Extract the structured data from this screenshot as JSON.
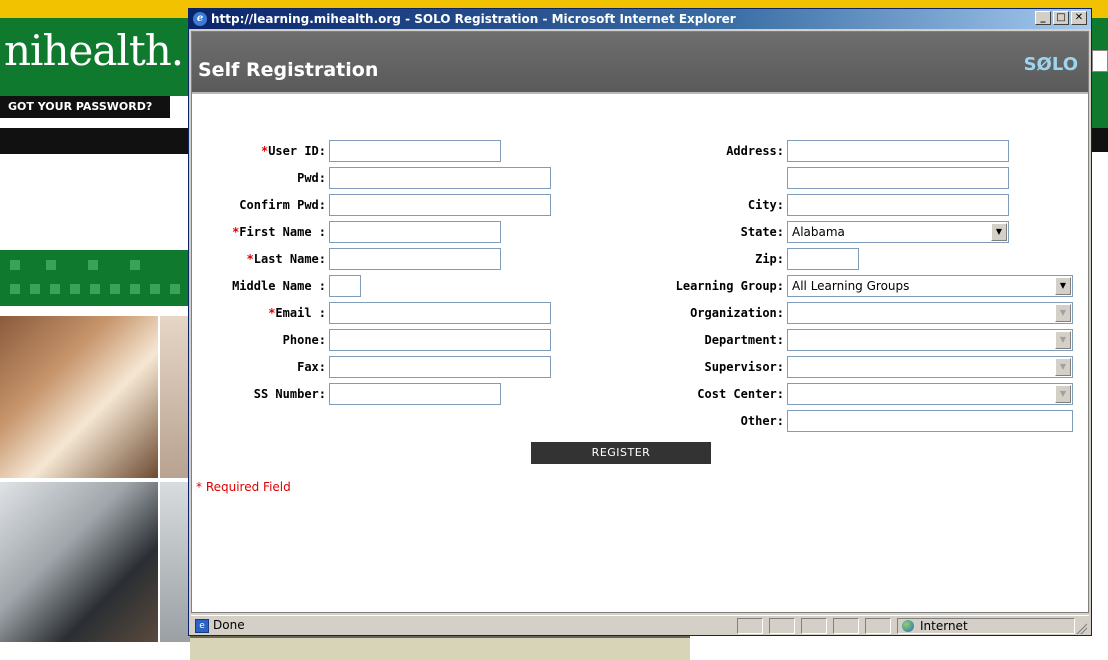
{
  "background": {
    "site_logo": "nihealth.",
    "forgot_text": "GOT YOUR PASSWORD?"
  },
  "window": {
    "title": "http://learning.mihealth.org - SOLO Registration - Microsoft Internet Explorer",
    "buttons": {
      "minimize": "_",
      "maximize": "□",
      "close": "✕"
    }
  },
  "header": {
    "title": "Self Registration",
    "logo_left": "S",
    "logo_o": "Ø",
    "logo_right": "LO"
  },
  "form": {
    "left": {
      "user_id_label": "User ID:",
      "pwd_label": "Pwd:",
      "confirm_pwd_label": "Confirm Pwd:",
      "first_name_label": "First Name :",
      "last_name_label": "Last Name:",
      "middle_name_label": "Middle Name :",
      "email_label": "Email :",
      "phone_label": "Phone:",
      "fax_label": "Fax:",
      "ss_number_label": "SS Number:",
      "required_mark": "*"
    },
    "right": {
      "address_label": "Address:",
      "city_label": "City:",
      "state_label": "State:",
      "state_value": "Alabama",
      "zip_label": "Zip:",
      "learning_group_label": "Learning Group:",
      "learning_group_value": "All Learning Groups",
      "organization_label": "Organization:",
      "department_label": "Department:",
      "supervisor_label": "Supervisor:",
      "cost_center_label": "Cost Center:",
      "other_label": "Other:"
    },
    "register_label": "REGISTER",
    "required_note": "* Required Field"
  },
  "status": {
    "text": "Done",
    "zone": "Internet"
  }
}
